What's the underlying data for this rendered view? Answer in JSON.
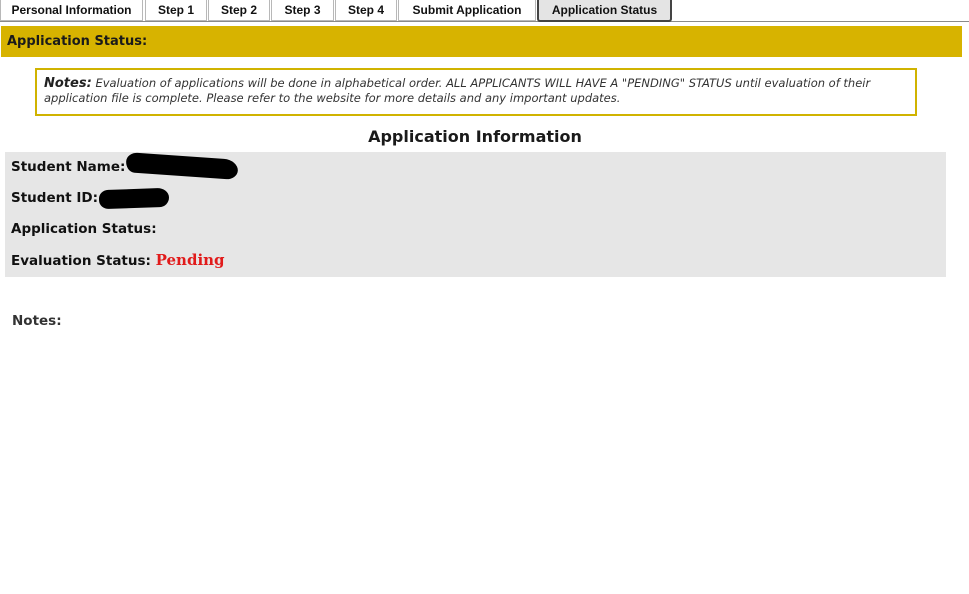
{
  "tabs": [
    {
      "label": "Personal Information",
      "active": false
    },
    {
      "label": "Step 1",
      "active": false
    },
    {
      "label": "Step 2",
      "active": false
    },
    {
      "label": "Step 3",
      "active": false
    },
    {
      "label": "Step 4",
      "active": false
    },
    {
      "label": "Submit Application",
      "active": false
    },
    {
      "label": "Application Status",
      "active": true
    }
  ],
  "header": {
    "title": "Application Status:"
  },
  "notes_box": {
    "label": "Notes:",
    "text": "Evaluation of applications will be done in alphabetical order. ALL APPLICANTS WILL HAVE A \"PENDING\" STATUS until evaluation of their application file is complete. Please refer to the website for more details and any important updates."
  },
  "section": {
    "title": "Application Information"
  },
  "info": {
    "student_name_label": "Student Name:",
    "student_id_label": "Student ID:",
    "application_status_label": "Application Status:",
    "application_status_value": "",
    "evaluation_status_label": "Evaluation Status:",
    "evaluation_status_value": "Pending"
  },
  "footer": {
    "notes_label": "Notes:"
  },
  "colors": {
    "header_bar": "#d7b300",
    "notes_border": "#d0b300",
    "pending": "#e11b1b",
    "panel_bg": "#e6e6e6"
  }
}
